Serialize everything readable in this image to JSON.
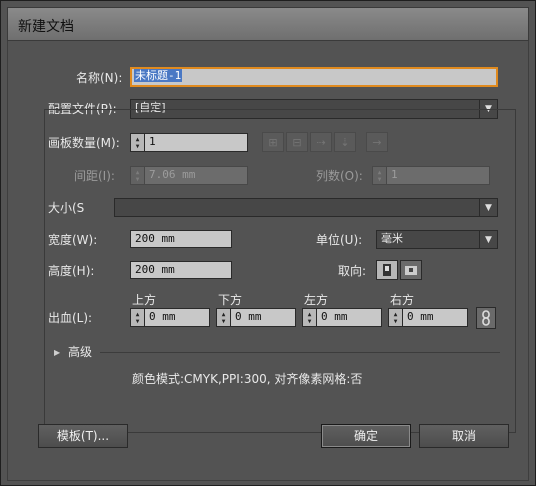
{
  "window": {
    "title": "新建文档"
  },
  "name": {
    "label": "名称(N):",
    "value": "未标题-1"
  },
  "profile": {
    "label": "配置文件(P):",
    "value": "[自定]"
  },
  "artboards": {
    "label": "画板数量(M):",
    "value": "1"
  },
  "spacing": {
    "label": "间距(I):",
    "value": "7.06 mm"
  },
  "columns": {
    "label": "列数(O):",
    "value": "1"
  },
  "size": {
    "label": "大小(S",
    "value": ""
  },
  "width": {
    "label": "宽度(W):",
    "value": "200 mm"
  },
  "units": {
    "label": "单位(U):",
    "value": "毫米"
  },
  "height": {
    "label": "高度(H):",
    "value": "200 mm"
  },
  "orientation": {
    "label": "取向:"
  },
  "bleed": {
    "label": "出血(L):",
    "top": {
      "label": "上方",
      "value": "0 mm"
    },
    "bottom": {
      "label": "下方",
      "value": "0 mm"
    },
    "left": {
      "label": "左方",
      "value": "0 mm"
    },
    "right": {
      "label": "右方",
      "value": "0 mm"
    }
  },
  "advanced": {
    "label": "高级"
  },
  "info": "颜色模式:CMYK,PPI:300, 对齐像素网格:否",
  "buttons": {
    "templates": "模板(T)...",
    "ok": "确定",
    "cancel": "取消"
  },
  "icons": {
    "arrange": [
      "grid-by-row-icon",
      "grid-by-column-icon",
      "arrange-by-row-icon",
      "arrange-by-column-icon",
      "right-to-left-icon"
    ],
    "orientation": [
      "portrait-icon",
      "landscape-icon"
    ],
    "link": "chain-link-icon"
  },
  "colors": {
    "focus": "#e08a1e",
    "selection": "#4a78c4",
    "panel": "#535353"
  }
}
